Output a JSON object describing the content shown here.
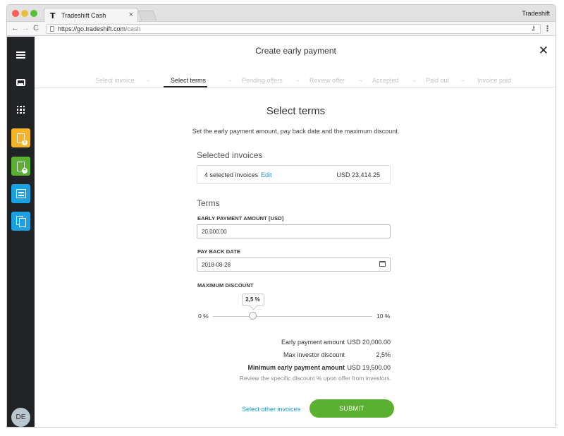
{
  "browser": {
    "tab_logo": "T",
    "tab_title": "Tradeshift Cash",
    "tab_close": "×",
    "profile_name": "Tradeshift",
    "url_scheme_host": "https://go.tradeshift.com",
    "url_path": "/cash",
    "nav_back": "←",
    "nav_forward": "→",
    "nav_reload": "C",
    "key_icon": "⚷",
    "menu_icon": "⋮"
  },
  "sidebar": {
    "avatar_initials": "DE",
    "icons": [
      "hamburger-icon",
      "inbox-icon",
      "apps-grid-icon",
      "invoice-dollar-icon",
      "invoice-add-icon",
      "drawer-icon",
      "copy-documents-icon"
    ],
    "colors": {
      "background": "#222327",
      "app_yellow": "#f5b326",
      "app_green": "#5ab031",
      "app_blue": "#1aa0e3"
    }
  },
  "header": {
    "title": "Create early payment",
    "close_icon": "✕"
  },
  "steps": [
    {
      "label": "Select invoice",
      "active": false
    },
    {
      "label": "Select terms",
      "active": true
    },
    {
      "label": "Pending offers",
      "active": false
    },
    {
      "label": "Review offer",
      "active": false
    },
    {
      "label": "Accepted",
      "active": false
    },
    {
      "label": "Paid out",
      "active": false
    },
    {
      "label": "Invoice paid",
      "active": false
    }
  ],
  "step_separator": "→",
  "main": {
    "title": "Select terms",
    "description": "Set the early payment amount, pay back date and the maximum discount."
  },
  "selected_invoices": {
    "heading": "Selected invoices",
    "count_label": "4 selected invoices",
    "edit_label": "Edit",
    "total": "USD 23,414.25"
  },
  "terms": {
    "heading": "Terms",
    "early_payment_label": "EARLY PAYMENT AMOUNT [USD]",
    "early_payment_value": "20,000.00",
    "pay_back_label": "PAY BACK DATE",
    "pay_back_value": "2018-08-28",
    "max_discount_label": "MAXIMUM DISCOUNT",
    "slider_min": "0 %",
    "slider_max": "10 %",
    "slider_value": "2,5 %",
    "slider_fraction": 0.25
  },
  "summary": [
    {
      "label": "Early payment amount",
      "value": "USD 20,000.00",
      "bold": false
    },
    {
      "label": "Max investor discount",
      "value": "2,5%",
      "bold": false
    },
    {
      "label": "Minimum early payment amount",
      "value": "USD 19,500.00",
      "bold": true
    }
  ],
  "review_note": "Review the specific discount % upon offer from investors.",
  "actions": {
    "other_invoices": "Select other invoices",
    "submit": "SUBMIT"
  },
  "colors": {
    "accent_blue": "#1a9ad6",
    "submit_green": "#5ab031",
    "inactive_step": "#c4c4c4"
  }
}
